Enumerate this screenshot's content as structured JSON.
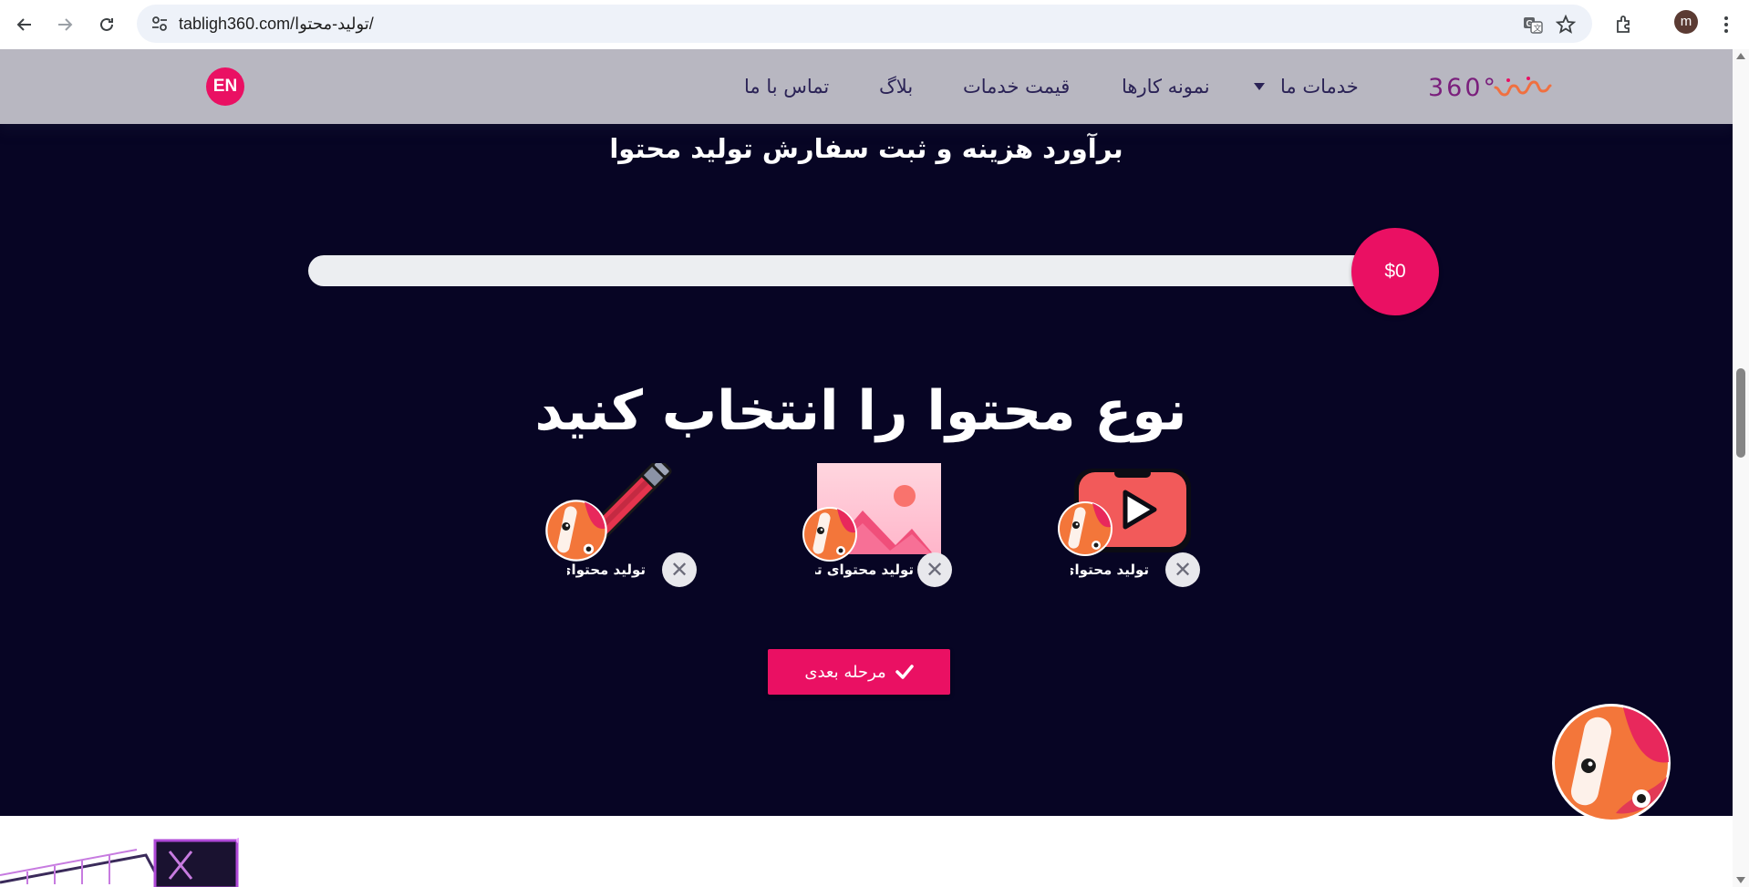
{
  "browser": {
    "url": "tabligh360.com/تولید-محتوا/",
    "profile_initial": "m",
    "icons": [
      "back-icon",
      "forward-icon",
      "reload-icon",
      "site-settings-icon",
      "translate-icon",
      "bookmark-star-icon",
      "extensions-icon",
      "menu-dots-icon"
    ]
  },
  "header": {
    "logo_text": "360°",
    "menu": {
      "services": "خدمات ما",
      "portfolio": "نمونه کارها",
      "pricing": "قیمت خدمات",
      "blog": "بلاگ",
      "contact": "تماس با ما"
    },
    "lang_label": "EN"
  },
  "hero": {
    "title": "برآورد هزینه و ثبت سفارش تولید محتوا",
    "price": "$0",
    "progress_fraction": 0,
    "heading": "نوع محتوا را انتخاب کنید",
    "options": [
      {
        "label": "تولید محتوای ویدئویی",
        "icon": "youtube-video-icon"
      },
      {
        "label": "تولید محتوای تصویری",
        "icon": "image-icon"
      },
      {
        "label": "تولید محتوای متنی",
        "icon": "pencil-icon"
      }
    ],
    "next_label": "مرحله بعدی"
  },
  "colors": {
    "accent": "#ea1063",
    "hero_bg": "#070524",
    "header_bg": "#b8b7c1",
    "menu_text": "#2b2356"
  }
}
